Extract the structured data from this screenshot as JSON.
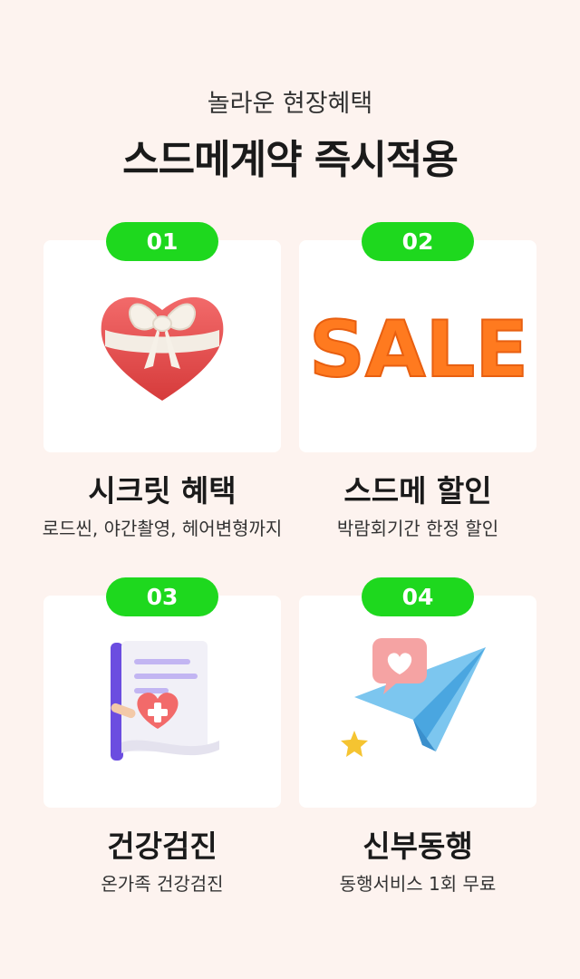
{
  "header": {
    "subtitle": "놀라운 현장혜택",
    "title": "스드메계약 즉시적용"
  },
  "benefits": [
    {
      "number": "01",
      "title": "시크릿 혜택",
      "description": "로드씬, 야간촬영, 헤어변형까지",
      "icon": "heart-gift-icon"
    },
    {
      "number": "02",
      "title": "스드메 할인",
      "description": "박람회기간 한정 할인",
      "icon": "sale-balloon-letters",
      "image_text": "SALE"
    },
    {
      "number": "03",
      "title": "건강검진",
      "description": "온가족 건강검진",
      "icon": "medical-document-icon"
    },
    {
      "number": "04",
      "title": "신부동행",
      "description": "동행서비스 1회 무료",
      "icon": "paper-plane-heart-icon"
    }
  ],
  "colors": {
    "background": "#fdf3ef",
    "badge": "#1ed81e",
    "card": "#ffffff"
  }
}
